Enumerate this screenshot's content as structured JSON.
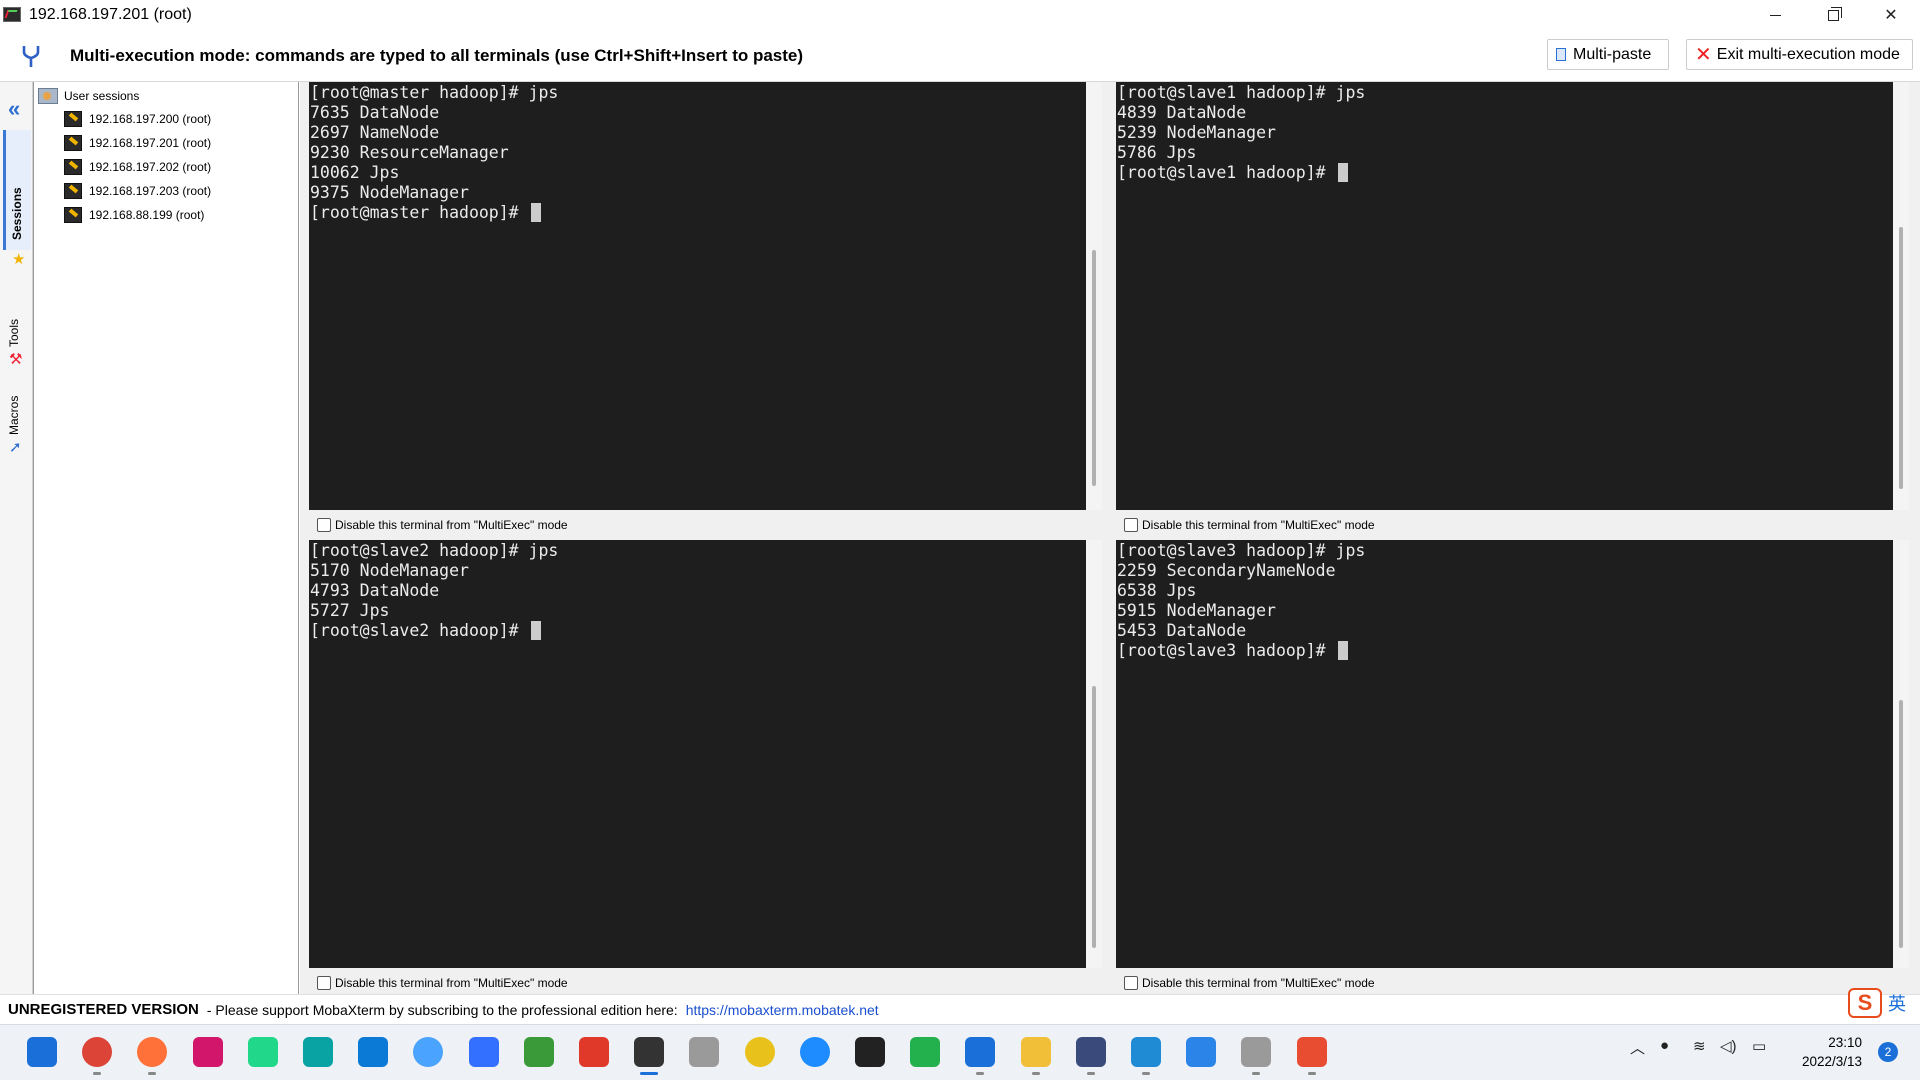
{
  "window": {
    "title": "192.168.197.201 (root)"
  },
  "modebar": {
    "message": "Multi-execution mode: commands are typed to all terminals (use Ctrl+Shift+Insert to paste)",
    "multipaste_label": "Multi-paste",
    "exit_label": "Exit multi-execution mode"
  },
  "sidebar": {
    "tabs": [
      "Sessions",
      "Tools",
      "Macros"
    ],
    "root_label": "User sessions",
    "sessions": [
      "192.168.197.200 (root)",
      "192.168.197.201 (root)",
      "192.168.197.202 (root)",
      "192.168.197.203 (root)",
      "192.168.88.199 (root)"
    ]
  },
  "terminals": [
    {
      "lines": [
        "[root@master hadoop]# jps",
        "7635 DataNode",
        "2697 NameNode",
        "9230 ResourceManager",
        "10062 Jps",
        "9375 NodeManager"
      ],
      "prompt": "[root@master hadoop]# ",
      "disable_label": "Disable this terminal from \"MultiExec\" mode"
    },
    {
      "lines": [
        "[root@slave1 hadoop]# jps",
        "4839 DataNode",
        "5239 NodeManager",
        "5786 Jps"
      ],
      "prompt": "[root@slave1 hadoop]# ",
      "disable_label": "Disable this terminal from \"MultiExec\" mode"
    },
    {
      "lines": [
        "[root@slave2 hadoop]# jps",
        "5170 NodeManager",
        "4793 DataNode",
        "5727 Jps"
      ],
      "prompt": "[root@slave2 hadoop]# ",
      "disable_label": "Disable this terminal from \"MultiExec\" mode"
    },
    {
      "lines": [
        "[root@slave3 hadoop]# jps",
        "2259 SecondaryNameNode",
        "6538 Jps",
        "5915 NodeManager",
        "5453 DataNode"
      ],
      "prompt": "[root@slave3 hadoop]# ",
      "disable_label": "Disable this terminal from \"MultiExec\" mode"
    }
  ],
  "statusbar": {
    "unregistered": "UNREGISTERED VERSION",
    "support": "-  Please support MobaXterm by subscribing to the professional edition here:",
    "url": "https://mobaxterm.mobatek.net"
  },
  "ime": {
    "logo": "S",
    "lang": "英"
  },
  "taskbar": {
    "apps": [
      {
        "name": "windows-start-icon",
        "color": "#1a6fd8"
      },
      {
        "name": "chrome-icon",
        "color": "#db4437"
      },
      {
        "name": "firefox-icon",
        "color": "#ff7139"
      },
      {
        "name": "intellij-icon",
        "color": "#d1166b"
      },
      {
        "name": "pycharm-icon",
        "color": "#21d789"
      },
      {
        "name": "vpn-icon",
        "color": "#0aa3a3"
      },
      {
        "name": "vscode-icon",
        "color": "#0a7ad6"
      },
      {
        "name": "browser-icon",
        "color": "#4aa3ff"
      },
      {
        "name": "feishu-icon",
        "color": "#3370ff"
      },
      {
        "name": "money-app-icon",
        "color": "#3a9a3a"
      },
      {
        "name": "snail-app-icon",
        "color": "#e0392a"
      },
      {
        "name": "mobaxterm-icon",
        "color": "#333333"
      },
      {
        "name": "typora-icon",
        "color": "#9a9a9a"
      },
      {
        "name": "sticker-app-icon",
        "color": "#e8c21a"
      },
      {
        "name": "tim-icon",
        "color": "#1e8bff"
      },
      {
        "name": "qq-icon",
        "color": "#222222"
      },
      {
        "name": "wechat-icon",
        "color": "#22b14c"
      },
      {
        "name": "network-app-icon",
        "color": "#1a6fd8"
      },
      {
        "name": "file-explorer-icon",
        "color": "#f2c038"
      },
      {
        "name": "avatar-app-icon",
        "color": "#3a4a7a"
      },
      {
        "name": "vm-app-icon",
        "color": "#1f8bd4"
      },
      {
        "name": "feishu2-icon",
        "color": "#2b85e8"
      },
      {
        "name": "typora2-icon",
        "color": "#9a9a9a"
      },
      {
        "name": "git-icon",
        "color": "#e84d31"
      }
    ],
    "time": "23:10",
    "date": "2022/3/13",
    "notifications": "2"
  }
}
